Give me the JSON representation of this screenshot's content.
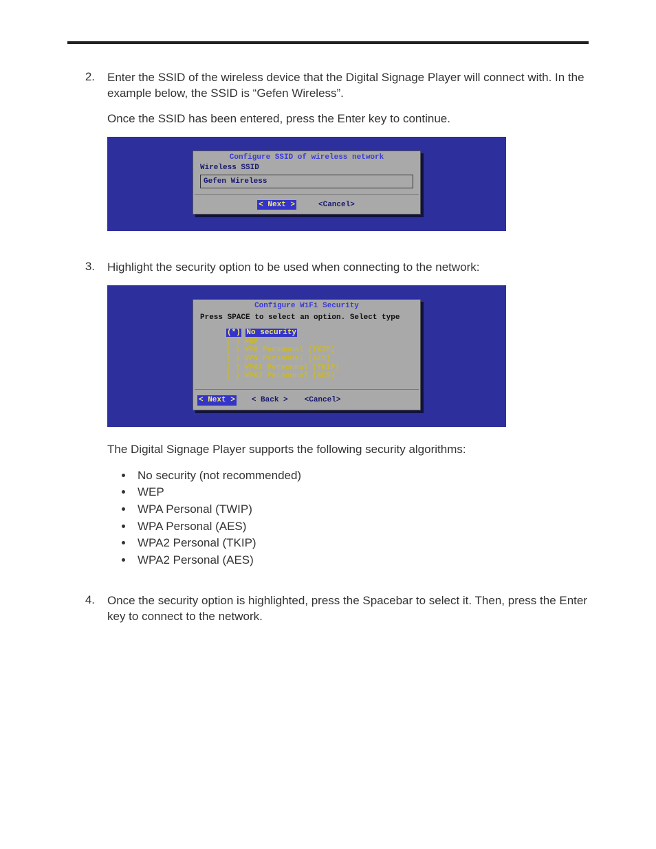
{
  "step2": {
    "number": "2.",
    "para1": "Enter the SSID of the wireless device that the Digital Signage Player will connect with.  In the example below, the SSID is “Gefen Wireless”.",
    "para2": "Once the SSID has been entered, press the Enter key to continue."
  },
  "dialog_ssid": {
    "title": "Configure SSID of wireless network",
    "label": "Wireless SSID",
    "value": "Gefen Wireless",
    "btn_next": "< Next >",
    "btn_cancel": "<Cancel>"
  },
  "step3": {
    "number": "3.",
    "para1": "Highlight the security option to be used when connecting to the network:"
  },
  "dialog_sec": {
    "title": "Configure WiFi Security",
    "instruction": "Press SPACE to select an option.  Select type",
    "options": [
      {
        "marker": "(*)",
        "label": "No security",
        "selected": true
      },
      {
        "marker": "( )",
        "label": "WEP",
        "selected": false
      },
      {
        "marker": "( )",
        "label": "WPA Personnal (TKIP)",
        "selected": false
      },
      {
        "marker": "( )",
        "label": "WPA Personnal (AES)",
        "selected": false
      },
      {
        "marker": "( )",
        "label": "WPA2 Personnal (TKIP)",
        "selected": false
      },
      {
        "marker": "( )",
        "label": "WPA2 Personnal (AES)",
        "selected": false
      }
    ],
    "btn_next": "< Next >",
    "btn_back": "< Back >",
    "btn_cancel": "<Cancel>"
  },
  "supports_text": "The Digital Signage Player supports the following security algorithms:",
  "bullets": [
    "No security (not recommended)",
    "WEP",
    "WPA Personal (TWIP)",
    "WPA Personal (AES)",
    "WPA2 Personal (TKIP)",
    "WPA2 Personal (AES)"
  ],
  "step4": {
    "number": "4.",
    "para1": "Once the security option is highlighted, press the Spacebar to select it.  Then, press the Enter key to connect to the network."
  }
}
